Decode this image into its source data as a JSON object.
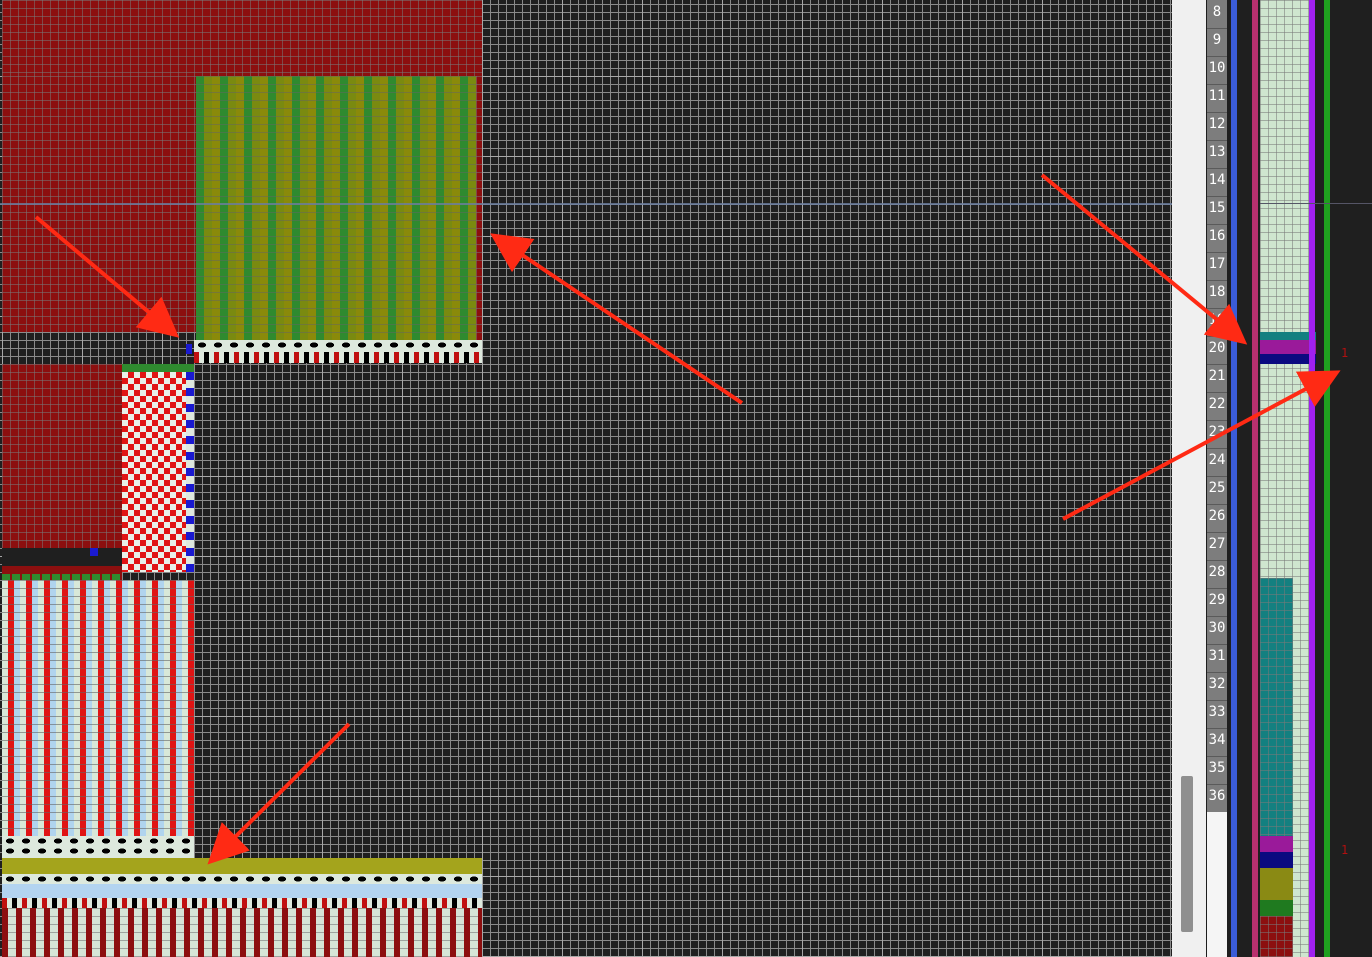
{
  "row_numbers": [
    "8",
    "9",
    "10",
    "11",
    "12",
    "13",
    "14",
    "15",
    "16",
    "17",
    "18",
    "19",
    "20",
    "21",
    "22",
    "23",
    "24",
    "25",
    "26",
    "27",
    "28",
    "29",
    "30",
    "31",
    "32",
    "33",
    "34",
    "35",
    "36"
  ],
  "colors": {
    "arrow": "#ff2a14",
    "dark_red": "#8c0f0f",
    "green": "#2f8a2f",
    "teal": "#138080",
    "magenta": "#9a1a9a",
    "navy": "#0a0a80",
    "olive": "#8a8a14",
    "light_blue": "#b3d4f0",
    "mint": "#cfe6cf"
  },
  "markers": [
    "1",
    "1"
  ]
}
